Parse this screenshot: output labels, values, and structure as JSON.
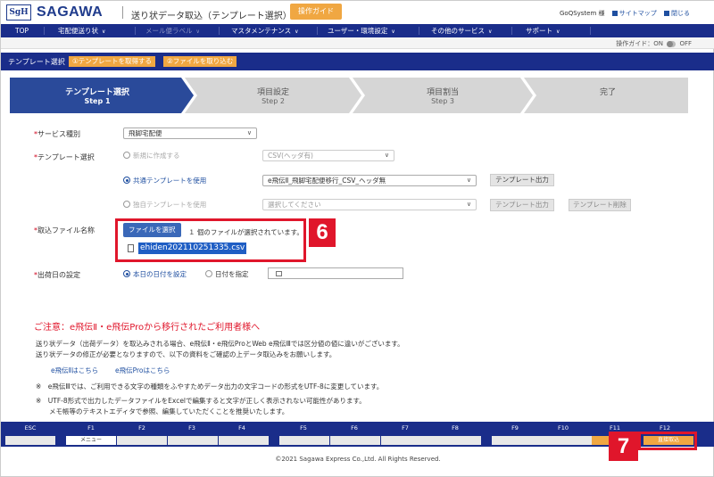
{
  "header": {
    "logo_mark": "SgH",
    "logo_text": "SAGAWA",
    "title": "送り状データ取込（テンプレート選択）",
    "guide_button": "操作ガイド",
    "user": "GoQSystem 様",
    "sitemap": "サイトマップ",
    "close": "閉じる"
  },
  "nav": {
    "items": [
      {
        "label": "TOP"
      },
      {
        "label": "宅配便送り状"
      },
      {
        "label": "メール便ラベル"
      },
      {
        "label": "マスタメンテナンス"
      },
      {
        "label": "ユーザー・環境設定"
      },
      {
        "label": "その他のサービス"
      },
      {
        "label": "サポート"
      }
    ]
  },
  "guidebar": {
    "label": "操作ガイド：ON",
    "off": "OFF"
  },
  "crumbbar": {
    "label": "テンプレート選択",
    "btn1": "①テンプレートを取得する",
    "btn2": "②ファイルを取り込む"
  },
  "steps": [
    {
      "title": "テンプレート選択",
      "sub": "Step 1"
    },
    {
      "title": "項目設定",
      "sub": "Step 2"
    },
    {
      "title": "項目割当",
      "sub": "Step 3"
    },
    {
      "title": "完了",
      "sub": ""
    }
  ],
  "form": {
    "service_label": "サービス種別",
    "service_value": "飛脚宅配便",
    "template_label": "テンプレート選択",
    "new_radio": "新規に作成する",
    "new_select": "CSV(ヘッダ有)",
    "shared_radio": "共通テンプレートを使用",
    "shared_select": "e飛伝Ⅱ_飛脚宅配便移行_CSV_ヘッダ無",
    "template_output": "テンプレート出力",
    "own_radio": "独自テンプレートを使用",
    "own_select": "選択してください",
    "template_delete": "テンプレート削除",
    "file_label": "取込ファイル名称",
    "file_button": "ファイルを選択",
    "file_message": "１ 個のファイルが選択されています。",
    "file_name": "ehiden202110251335.csv",
    "ship_label": "出荷日の設定",
    "ship_today": "本日の日付を設定",
    "ship_specify": "日付を指定"
  },
  "markers": {
    "m6": "6",
    "m7": "7"
  },
  "notice": {
    "title": "ご注意：e飛伝Ⅱ・e飛伝Proから移行されたご利用者様へ",
    "line1": "送り状データ（出荷データ）を取込みされる場合、e飛伝Ⅱ・e飛伝ProとWeb e飛伝Ⅲでは区分値の値に違いがございます。",
    "line2": "送り状データの修正が必要となりますので、以下の資料をご確認の上データ取込みをお願いします。",
    "link1": "e飛伝Ⅱはこちら",
    "link2": "e飛伝Proはこちら",
    "note1": "※　e飛伝Ⅲでは、ご利用できる文字の種類をふやすためデータ出力の文字コードの形式をUTF-8に変更しています。",
    "note2": "※　UTF-8形式で出力したデータファイルをExcelで編集すると文字が正しく表示されない可能性があります。",
    "note3": "　　メモ帳等のテキストエディタで参照、編集していただくことを推奨いたします。"
  },
  "fkeys": {
    "labels": [
      "ESC",
      "F1",
      "F2",
      "F3",
      "F4",
      "F5",
      "F6",
      "F7",
      "F8",
      "F9",
      "F10",
      "F11",
      "F12"
    ],
    "menu": "メニュー",
    "import": "直接取込"
  },
  "copyright": "©2021 Sagawa Express Co.,Ltd. All Rights Reserved."
}
